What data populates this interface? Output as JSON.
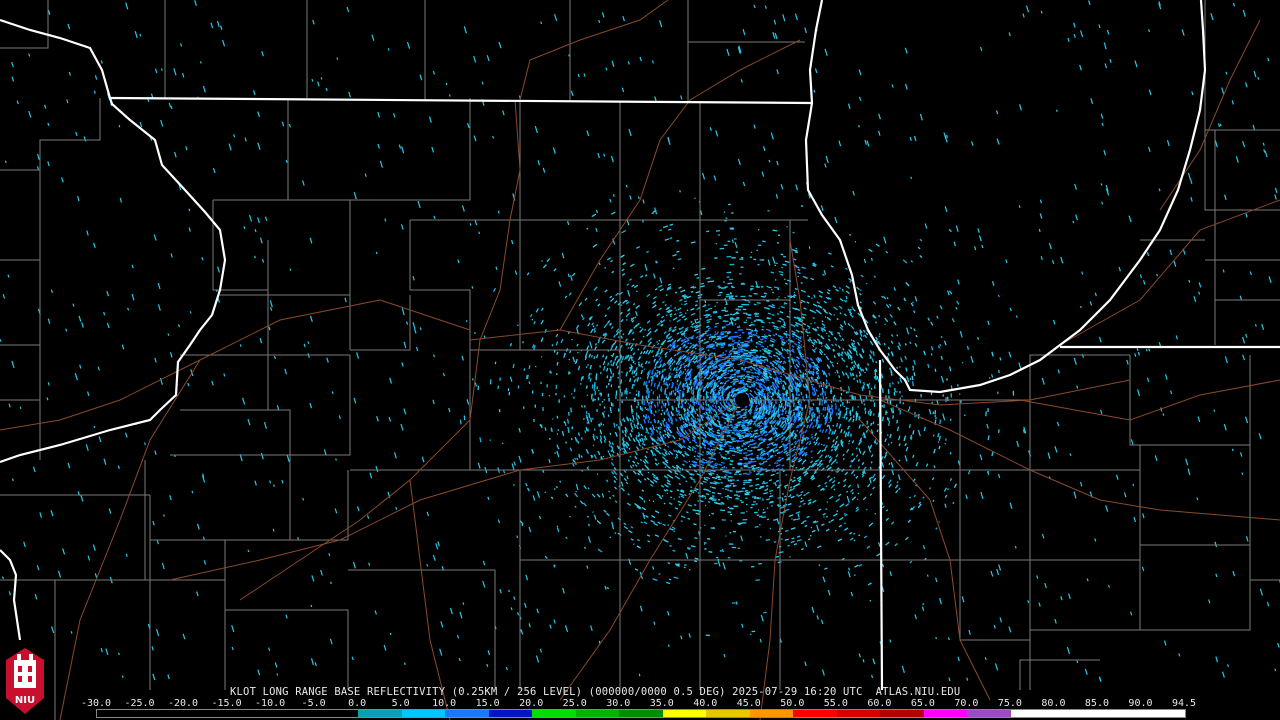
{
  "product": {
    "header": "KLOT LONG RANGE BASE REFLECTIVITY (0.25KM / 256 LEVEL) (000000/0000 0.5 DEG) 2025-07-29 16:20 UTC  ATLAS.NIU.EDU"
  },
  "logo": {
    "text": "NIU",
    "color": "#c8102e"
  },
  "scale": {
    "labels": [
      "-30.0",
      "-25.0",
      "-20.0",
      "-15.0",
      "-10.0",
      "-5.0",
      "0.0",
      "5.0",
      "10.0",
      "15.0",
      "20.0",
      "25.0",
      "30.0",
      "35.0",
      "40.0",
      "45.0",
      "50.0",
      "55.0",
      "60.0",
      "65.0",
      "70.0",
      "75.0",
      "80.0",
      "85.0",
      "90.0",
      "94.5"
    ],
    "colors": [
      "#000000",
      "#000000",
      "#000000",
      "#000000",
      "#000000",
      "#000000",
      "#0aa0b4",
      "#00c8ff",
      "#1e78ff",
      "#0014c8",
      "#00e000",
      "#00b400",
      "#008c00",
      "#ffff00",
      "#e6c800",
      "#ff9600",
      "#ff0000",
      "#d20000",
      "#b40000",
      "#ff00ff",
      "#9c4cc0",
      "#ffffff",
      "#ffffff",
      "#ffffff",
      "#ffffff"
    ]
  },
  "map": {
    "radar_echo_color": "#28c8e8",
    "radar_core_color": "#1e78ff",
    "state_border_color": "#ffffff",
    "county_border_color": "#7a7a7a",
    "road_color": "#8a4a2a"
  }
}
